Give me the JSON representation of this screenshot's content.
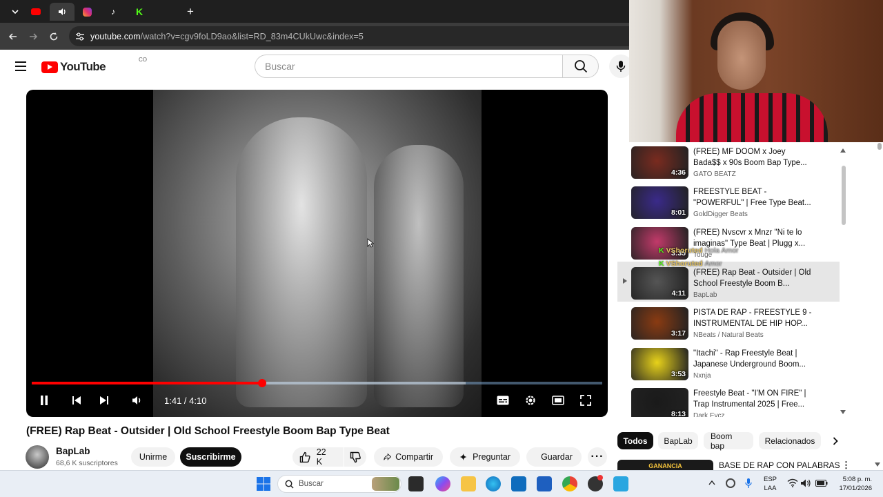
{
  "browser": {
    "url_host": "youtube.com",
    "url_path": "/watch?v=cgv9foLD9ao&list=RD_83m4CUkUwc&index=5"
  },
  "header": {
    "logo_text": "YouTube",
    "country": "CO",
    "search_placeholder": "Buscar"
  },
  "player": {
    "time": "1:41 / 4:10",
    "progress_fraction": 0.404,
    "buffer_fraction": 0.76
  },
  "video": {
    "title": "(FREE) Rap Beat - Outsider | Old School Freestyle Boom Bap Type Beat",
    "channel": "BapLab",
    "subscribers": "68,6 K suscriptores",
    "join_label": "Unirme",
    "subscribe_label": "Suscribirme",
    "likes": "22 K",
    "share_label": "Compartir",
    "ask_label": "Preguntar",
    "save_label": "Guardar"
  },
  "playlist": [
    {
      "title": "(FREE) MF DOOM x Joey Bada$$ x 90s Boom Bap Type...",
      "channel": "GATO BEATZ",
      "duration": "4:36",
      "color": "#7a2b1f"
    },
    {
      "title": "FREESTYLE BEAT - \"POWERFUL\" | Free Type Beat...",
      "channel": "GoldDigger Beats",
      "duration": "8:01",
      "color": "#3a2a8a"
    },
    {
      "title": "(FREE) Nvscvr x Mnzr \"Ni te lo imaginas\" Type Beat | Plugg x...",
      "channel": "Touge",
      "duration": "3:35",
      "color": "#c23a6a"
    },
    {
      "title": "(FREE) Rap Beat - Outsider | Old School Freestyle Boom B...",
      "channel": "BapLab",
      "duration": "4:11",
      "color": "#555555"
    },
    {
      "title": "PISTA DE RAP - FREESTYLE 9 - INSTRUMENTAL DE HIP HOP...",
      "channel": "NBeats / Natural Beats",
      "duration": "3:17",
      "color": "#8a3b12"
    },
    {
      "title": "\"Itachi\" - Rap Freestyle Beat | Japanese Underground Boom...",
      "channel": "Nxnja",
      "duration": "3:53",
      "color": "#e8d21a"
    },
    {
      "title": "Freestyle Beat - \"I'M ON FIRE\" | Trap Instrumental 2025 | Free...",
      "channel": "Dark Evcz",
      "duration": "8:13",
      "color": "#1a1a1a"
    }
  ],
  "chips": [
    "Todos",
    "BapLab",
    "Boom bap",
    "Relacionados"
  ],
  "next_item": {
    "title": "BASE DE RAP CON PALABRAS",
    "thumb_text": "GANANCIA"
  },
  "taskbar": {
    "search_placeholder": "Buscar",
    "lang": "ESP",
    "lang2": "LAA",
    "time": "5:08 p. m.",
    "date": "17/01/2026"
  },
  "overlay": {
    "notice1": "Hola Amor",
    "notice1_user": "VShoruted",
    "notice2": "Amor",
    "notice2_user": "VShoruted"
  }
}
